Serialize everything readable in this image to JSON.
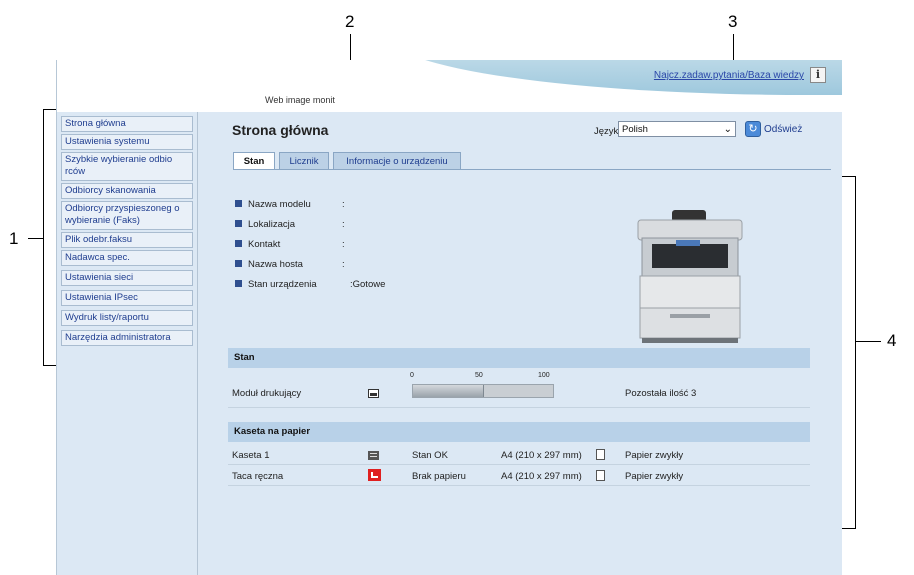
{
  "callouts": [
    "1",
    "2",
    "3",
    "4"
  ],
  "header": {
    "faq_link": "Najcz.zadaw.pytania/Baza wiedzy",
    "info_icon": "i",
    "app_title": "Web image monit"
  },
  "sidebar": {
    "items": [
      {
        "label": "Strona główna"
      },
      {
        "label": "Ustawienia systemu"
      },
      {
        "label": "Szybkie wybieranie odbio rców"
      },
      {
        "label": "Odbiorcy skanowania"
      },
      {
        "label": "Odbiorcy przyspieszoneg o wybieranie (Faks)"
      },
      {
        "label": "Plik odebr.faksu"
      },
      {
        "label": "Nadawca spec."
      },
      {
        "label": "Ustawienia sieci"
      },
      {
        "label": "Ustawienia IPsec"
      },
      {
        "label": "Wydruk listy/raportu"
      },
      {
        "label": "Narzędzia administratora"
      }
    ]
  },
  "main": {
    "title": "Strona główna",
    "language_label": "Język",
    "language_value": "Polish",
    "refresh_label": "Odśwież",
    "tabs": [
      {
        "label": "Stan"
      },
      {
        "label": "Licznik"
      },
      {
        "label": "Informacje o urządzeniu"
      }
    ],
    "info": [
      {
        "label": "Nazwa modelu",
        "value": ":"
      },
      {
        "label": "Lokalizacja",
        "value": ":"
      },
      {
        "label": "Kontakt",
        "value": ":"
      },
      {
        "label": "Nazwa hosta",
        "value": ":"
      },
      {
        "label": "Stan urządzenia",
        "value": ":Gotowe"
      }
    ],
    "status_section": {
      "title": "Stan",
      "scale": [
        "0",
        "50",
        "100"
      ],
      "module_label": "Moduł drukujący",
      "module_level_percent": 50,
      "remaining": "Pozostała ilość 3"
    },
    "tray_section": {
      "title": "Kaseta na papier",
      "rows": [
        {
          "name": "Kaseta 1",
          "status": "Stan OK",
          "size": "A4 (210 x 297 mm)",
          "type": "Papier zwykły",
          "icon": "tray-ok-icon",
          "color": "#555555"
        },
        {
          "name": "Taca ręczna",
          "status": "Brak papieru",
          "size": "A4 (210 x 297 mm)",
          "type": "Papier zwykły",
          "icon": "tray-empty-icon",
          "color": "#e02020"
        }
      ]
    }
  },
  "colors": {
    "accent": "#1f3d8f",
    "panel": "#dce8f4",
    "section": "#b8d1e8"
  }
}
